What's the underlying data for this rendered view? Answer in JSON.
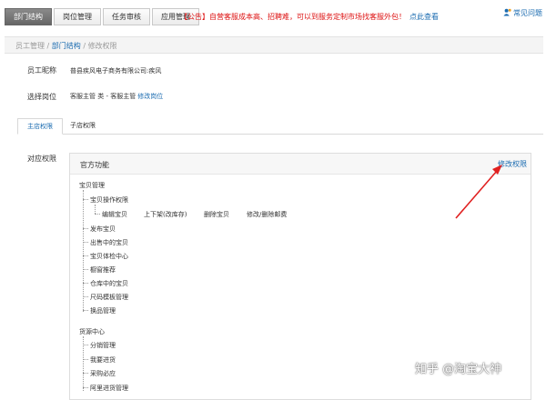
{
  "top_tabs": [
    "部门结构",
    "岗位管理",
    "任务审核",
    "应用管理"
  ],
  "notice": {
    "text": "【公告】自营客服成本高、招聘难，可以到服务定制市场找客服外包！",
    "link": "点此查看"
  },
  "faq": "常见问题",
  "breadcrumb": {
    "item1": "员工管理",
    "sep": " / ",
    "item2": "部门结构",
    "item3": "修改权限"
  },
  "employee": {
    "label": "员工昵称",
    "value": "普县疾风电子商务有限公司:疾风"
  },
  "position": {
    "label": "选择岗位",
    "value": "客服主管 类 - 客服主管",
    "link": "修改岗位"
  },
  "sub_tabs": [
    "主店权限",
    "子店权限"
  ],
  "perm_label": "对应权限",
  "panel": {
    "title": "官方功能",
    "edit": "修改权限"
  },
  "tree": {
    "baby": "宝贝管理",
    "baby_ops": "宝贝操作权限",
    "ops": [
      "编辑宝贝",
      "上下架(改库存)",
      "删除宝贝",
      "修改/删除邮费"
    ],
    "items": [
      "发布宝贝",
      "出售中的宝贝",
      "宝贝体检中心",
      "橱窗推荐",
      "仓库中的宝贝",
      "尺码模板管理",
      "换品管理"
    ],
    "resource": "货源中心",
    "resource_items": [
      "分销管理",
      "我要进货",
      "采购必应",
      "阿里进货管理"
    ]
  },
  "watermark": "知乎 @淘宝大神"
}
